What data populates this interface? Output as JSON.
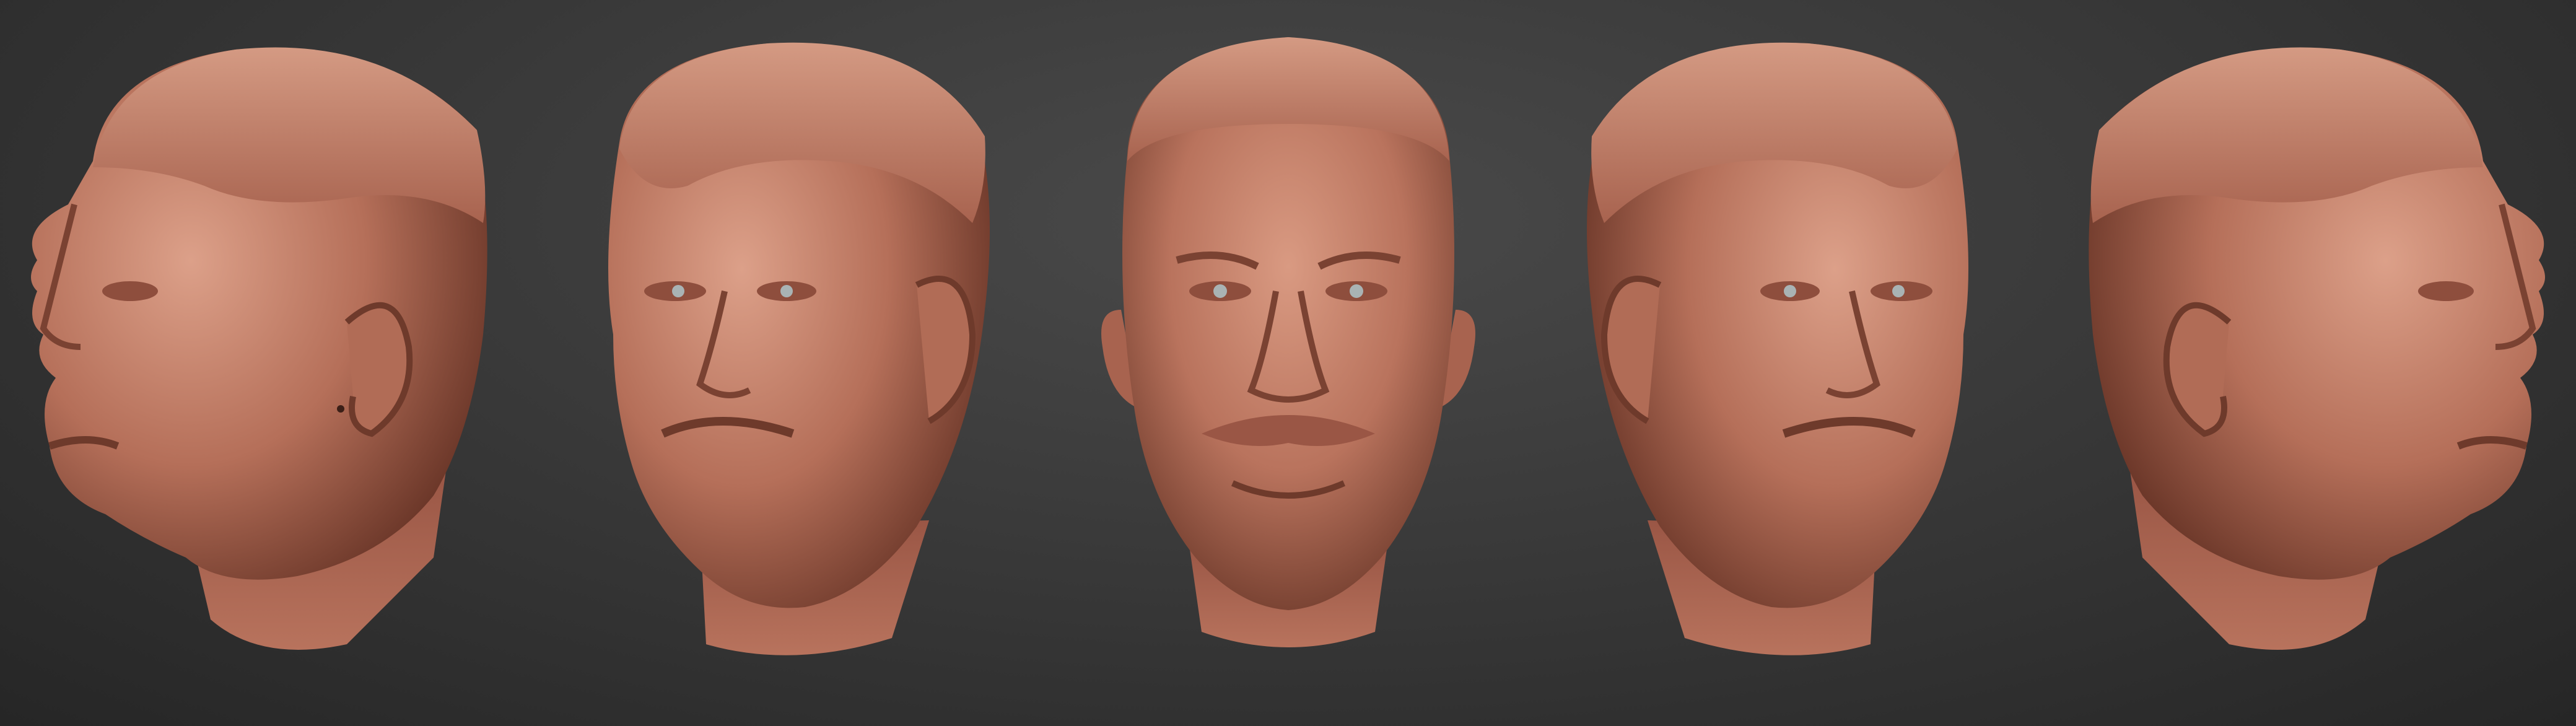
{
  "scene": {
    "background_color": "#383838",
    "clay_color": "#c07a64",
    "clay_shadow": "#6e3a2b",
    "clay_highlight": "#e2a58e",
    "eye_color": "#a9b3b4"
  },
  "views": [
    {
      "name": "left-profile-view",
      "icon": "sculpted-head-profile-left"
    },
    {
      "name": "left-three-quarter-view",
      "icon": "sculpted-head-three-quarter-left"
    },
    {
      "name": "front-view",
      "icon": "sculpted-head-front"
    },
    {
      "name": "right-three-quarter-view",
      "icon": "sculpted-head-three-quarter-right"
    },
    {
      "name": "right-profile-view",
      "icon": "sculpted-head-profile-right"
    }
  ]
}
